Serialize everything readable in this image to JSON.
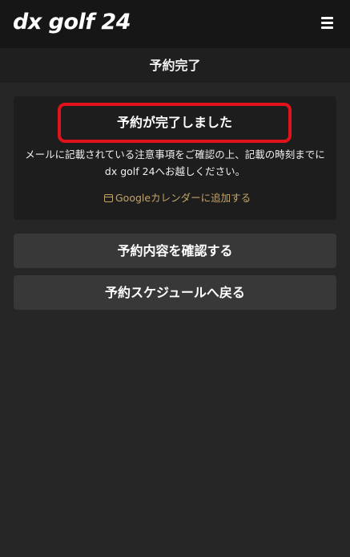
{
  "app": {
    "logo_text": "dx golf 24"
  },
  "header": {
    "title": "予約完了"
  },
  "completion": {
    "message": "予約が完了しました",
    "notice_line1": "メールに記載されている注意事項をご確認の上、記載の時刻までに",
    "notice_line2": "dx golf 24へお越しください。",
    "calendar_link": "Googleカレンダーに追加する"
  },
  "actions": {
    "view_reservation": "予約内容を確認する",
    "back_to_schedule": "予約スケジュールへ戻る"
  },
  "icons": {
    "menu": "hamburger-menu-icon",
    "calendar": "calendar-icon"
  },
  "colors": {
    "highlight_border": "#e0131a",
    "link_gold": "#c3a468",
    "background": "#262626"
  }
}
